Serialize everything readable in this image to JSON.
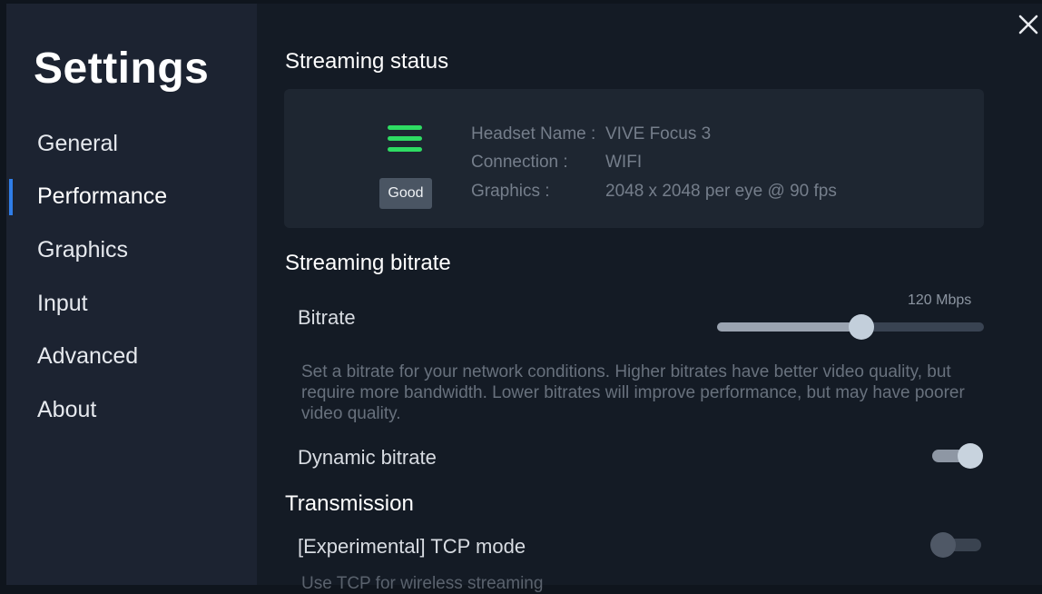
{
  "sidebar": {
    "title": "Settings",
    "items": [
      {
        "label": "General"
      },
      {
        "label": "Performance",
        "active": true
      },
      {
        "label": "Graphics"
      },
      {
        "label": "Input"
      },
      {
        "label": "Advanced"
      },
      {
        "label": "About"
      }
    ]
  },
  "streaming_status": {
    "title": "Streaming status",
    "signal_icon": "signal-bars-icon",
    "signal_color": "#2edc63",
    "badge": "Good",
    "headset_key": "Headset Name :",
    "headset_value": "VIVE Focus 3",
    "connection_key": "Connection :",
    "connection_value": "WIFI",
    "graphics_key": "Graphics :",
    "graphics_value": "2048 x 2048 per eye @ 90 fps"
  },
  "streaming_bitrate": {
    "title": "Streaming bitrate",
    "bitrate_label": "Bitrate",
    "bitrate_value": "120 Mbps",
    "bitrate_fraction": 0.54,
    "description": "Set a bitrate for your network conditions. Higher bitrates have better video quality, but require more bandwidth. Lower bitrates will improve performance, but may have poorer video quality.",
    "dynamic_label": "Dynamic bitrate",
    "dynamic_on": true
  },
  "transmission": {
    "title": "Transmission",
    "tcp_label": "[Experimental] TCP mode",
    "tcp_on": false,
    "tcp_description": "Use TCP for wireless streaming"
  },
  "close_icon": "close-icon",
  "accent_color": "#2f7de8"
}
